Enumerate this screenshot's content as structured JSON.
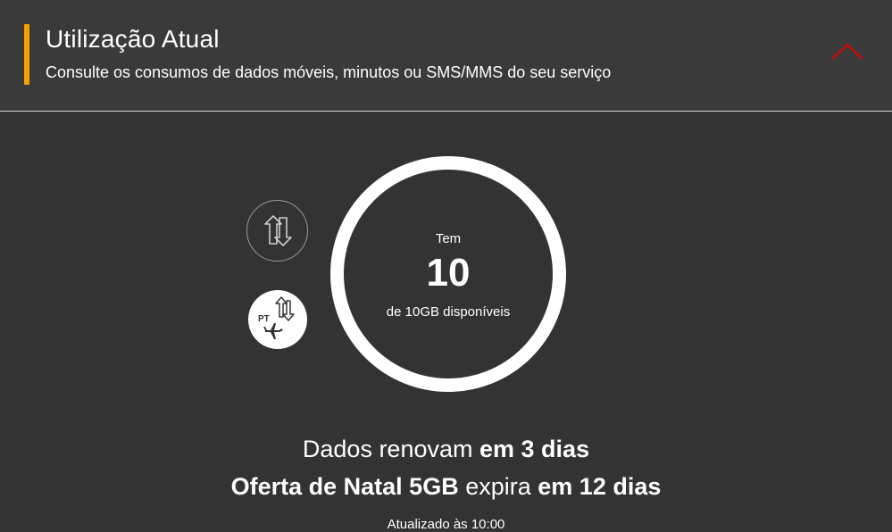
{
  "header": {
    "title": "Utilização Atual",
    "subtitle": "Consulte os consumos de dados móveis, minutos ou SMS/MMS do seu serviço",
    "accent_color": "#f4a100",
    "collapse_icon": "chevron-up-icon",
    "collapse_icon_color": "#e60000"
  },
  "tabs": [
    {
      "name": "mobile-data",
      "icon": "data-arrows-icon",
      "selected": false
    },
    {
      "name": "roaming-data",
      "icon": "roaming-data-icon",
      "badge_text": "PT",
      "selected": true
    }
  ],
  "usage": {
    "label_top": "Tem",
    "value": "10",
    "label_bottom": "de 10GB disponíveis",
    "fraction_remaining": 1.0
  },
  "info": {
    "renew_prefix": "Dados renovam",
    "renew_bold": "em 3 dias",
    "offer_bold": "Oferta de Natal 5GB",
    "offer_middle": "expira",
    "offer_expiry_bold": "em 12 dias",
    "updated": "Atualizado às 10:00"
  }
}
